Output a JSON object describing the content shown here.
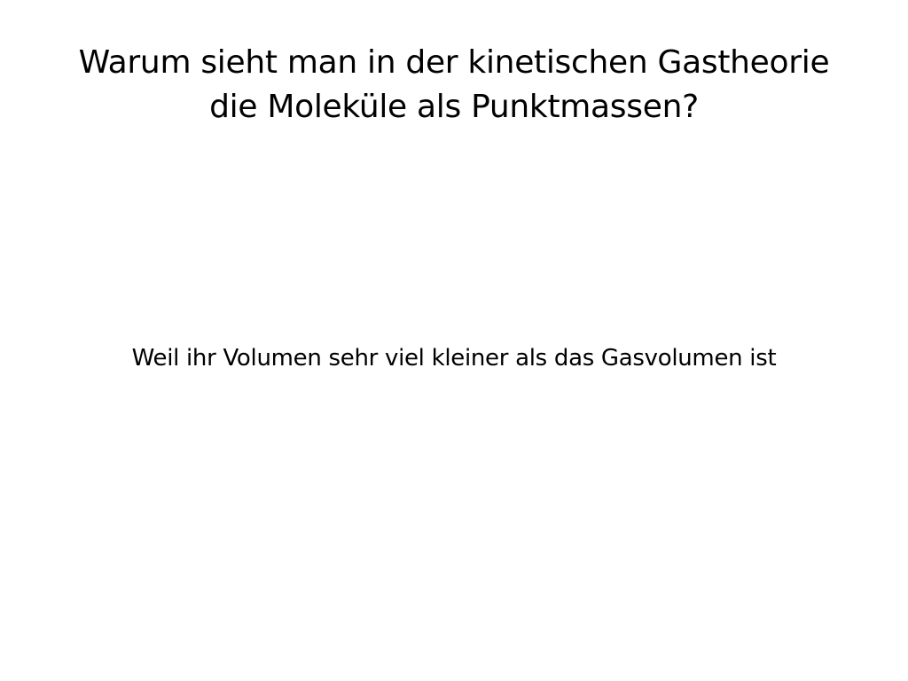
{
  "slide": {
    "title_line_1": "Warum sieht man in der kinetischen Gastheorie",
    "title_line_2": "die Moleküle als Punktmassen?",
    "answer": "Weil ihr Volumen sehr viel kleiner als das Gasvolumen ist"
  }
}
